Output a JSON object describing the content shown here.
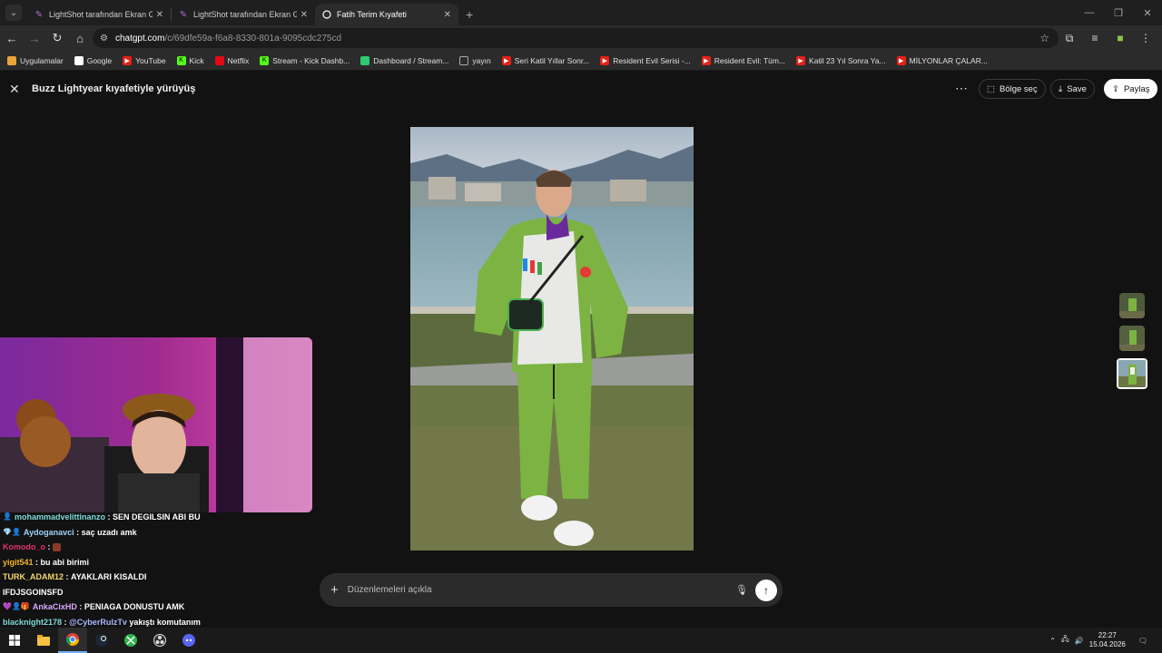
{
  "browser": {
    "tabs": [
      {
        "title": "LightShot tarafından Ekran Gör",
        "active": false
      },
      {
        "title": "LightShot tarafından Ekran Gör",
        "active": false
      },
      {
        "title": "Fatih Terim Kıyafeti",
        "active": true
      }
    ],
    "url_host": "chatgpt.com",
    "url_path": "/c/69dfe59a-f6a8-8330-801a-9095cdc275cd"
  },
  "bookmarks": [
    {
      "label": "Uygulamalar",
      "icon": "apps-grid-icon",
      "color": "#e8a33d"
    },
    {
      "label": "Google",
      "icon": "google-icon",
      "color": "#ffffff"
    },
    {
      "label": "YouTube",
      "icon": "youtube-icon",
      "color": "#e62117"
    },
    {
      "label": "Kick",
      "icon": "kick-icon",
      "color": "#53fc18"
    },
    {
      "label": "Netflix",
      "icon": "netflix-icon",
      "color": "#e50914"
    },
    {
      "label": "Stream - Kick Dashb...",
      "icon": "kick-icon",
      "color": "#53fc18"
    },
    {
      "label": "Dashboard / Stream...",
      "icon": "dashboard-icon",
      "color": "#2ecc71"
    },
    {
      "label": "yayın",
      "icon": "folder-icon",
      "color": "#888888"
    },
    {
      "label": "Seri Katil Yıllar Sonr...",
      "icon": "youtube-icon",
      "color": "#e62117"
    },
    {
      "label": "Resident Evil Serisi -...",
      "icon": "youtube-icon",
      "color": "#e62117"
    },
    {
      "label": "Resident Evil: Tüm...",
      "icon": "youtube-icon",
      "color": "#e62117"
    },
    {
      "label": "Katil 23 Yıl Sonra Ya...",
      "icon": "youtube-icon",
      "color": "#e62117"
    },
    {
      "label": "MİLYONLAR ÇALAR...",
      "icon": "youtube-icon",
      "color": "#e62117"
    }
  ],
  "header": {
    "title": "Buzz Lightyear kıyafetiyle yürüyüş",
    "select_area": "Bölge seç",
    "save": "Save",
    "share": "Paylaş"
  },
  "chat": [
    {
      "user": "mohammadvelittinanzo",
      "msg": "SEN DEGILSIN ABI BU",
      "color": "#7fd9d9",
      "badge": "👤"
    },
    {
      "user": "Aydoganavci",
      "msg": "saç uzadı amk",
      "color": "#9fd4ff",
      "badge": "💎👤"
    },
    {
      "user": "Komodo_o",
      "msg": "",
      "color": "#e0306a",
      "badge": ""
    },
    {
      "user": "yigit541",
      "msg": "bu abi birimi",
      "color": "#f0b429",
      "badge": ""
    },
    {
      "user": "TURK_ADAM12",
      "msg": "AYAKLARI KISALDI",
      "color": "#f5d76e",
      "badge": ""
    },
    {
      "user": "",
      "msg": "IFDJSGOINSFD",
      "color": "#ffffff",
      "badge": ""
    },
    {
      "user": "AnkaCixHD",
      "msg": "PENIAGA DONUSTU AMK",
      "color": "#d9a8ff",
      "badge": "💜👤🎁"
    },
    {
      "user": "blacknight2178",
      "msg": "@CyberRulzTv yakıştı komutanım",
      "color": "#7fd9d9",
      "badge": ""
    }
  ],
  "composer": {
    "placeholder": "Düzenlemeleri açıkla"
  },
  "clock": {
    "time": "22:27",
    "date": "15.04.2026"
  }
}
